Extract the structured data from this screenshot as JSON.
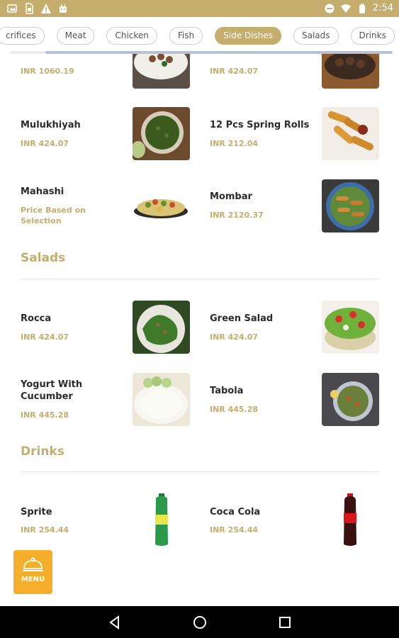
{
  "status_bar": {
    "time": "2:54",
    "left_icons": [
      "image-icon",
      "sim-icon",
      "warning-icon",
      "android-icon"
    ],
    "right_icons": [
      "do-not-disturb-icon",
      "wifi-icon",
      "battery-icon"
    ]
  },
  "categories": [
    {
      "label": "crifices",
      "active": false
    },
    {
      "label": "Meat",
      "active": false
    },
    {
      "label": "Chicken",
      "active": false
    },
    {
      "label": "Fish",
      "active": false
    },
    {
      "label": "Side Dishes",
      "active": true
    },
    {
      "label": "Salads",
      "active": false
    },
    {
      "label": "Drinks",
      "active": false
    }
  ],
  "side_dishes": [
    {
      "name": "",
      "price": "INR 1060.19"
    },
    {
      "name": "",
      "price": "INR 424.07"
    },
    {
      "name": "Mulukhiyah",
      "price": "INR 424.07"
    },
    {
      "name": "12 Pcs Spring Rolls",
      "price": "INR 212.04"
    },
    {
      "name": "Mahashi",
      "price": "Price Based on Selection"
    },
    {
      "name": "Mombar",
      "price": "INR 2120.37"
    }
  ],
  "salads": {
    "title": "Salads",
    "items": [
      {
        "name": "Rocca",
        "price": "INR 424.07"
      },
      {
        "name": "Green Salad",
        "price": "INR 424.07"
      },
      {
        "name": "Yogurt With Cucumber",
        "price": "INR 445.28"
      },
      {
        "name": "Tabola",
        "price": "INR 445.28"
      }
    ]
  },
  "drinks": {
    "title": "Drinks",
    "items": [
      {
        "name": "Sprite",
        "price": "INR 254.44"
      },
      {
        "name": "Coca Cola",
        "price": "INR 254.44"
      }
    ]
  },
  "menu_button": {
    "label": "MENU",
    "icon": "cloche-icon"
  },
  "nav_bar": {
    "buttons": [
      "back-icon",
      "home-icon",
      "recents-icon"
    ]
  },
  "colors": {
    "accent": "#c5ad6d",
    "menu_button": "#f5ae2b",
    "text": "#2b2b2b"
  }
}
